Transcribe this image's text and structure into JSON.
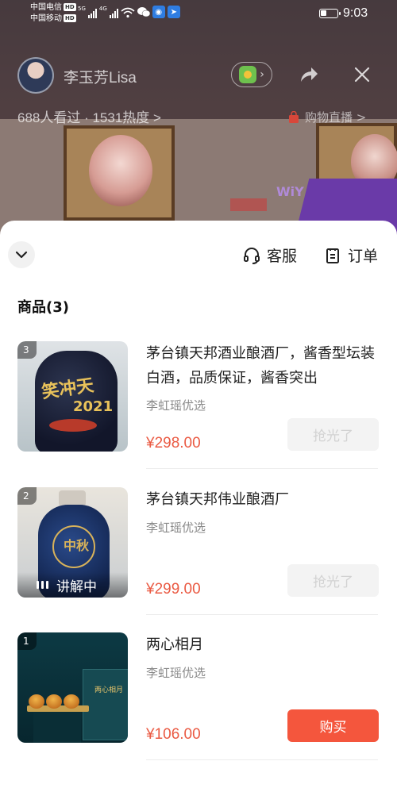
{
  "status_bar": {
    "carrier1": "中国电信",
    "carrier2": "中国移动",
    "hd_badge": "HD",
    "net1": "5G",
    "net2": "4G",
    "time": "9:03",
    "icons": [
      "signal-icon",
      "wifi-icon",
      "wechat-icon",
      "browser-icon",
      "message-icon"
    ]
  },
  "live": {
    "host_name": "李玉芳Lisa",
    "watch_info": "688人看过 · 1531热度 >",
    "shop_live": "购物直播 >"
  },
  "sheet": {
    "customer_service": "客服",
    "orders": "订单",
    "goods_title": "商品(3)"
  },
  "products": [
    {
      "index": "3",
      "title": "茅台镇天邦酒业酿酒厂，酱香型坛装白酒，品质保证，酱香突出",
      "seller": "李虹瑶优选",
      "price": "¥298.00",
      "button": "抢光了",
      "art_text": "笑冲天",
      "art_num": "2021"
    },
    {
      "index": "2",
      "title": "茅台镇天邦伟业酿酒厂",
      "seller": "李虹瑶优选",
      "price": "¥299.00",
      "button": "抢光了",
      "explaining": "讲解中",
      "art_text": "中秋"
    },
    {
      "index": "1",
      "title": "两心相月",
      "seller": "李虹瑶优选",
      "price": "¥106.00",
      "button": "购买",
      "art_text": "两心相月"
    }
  ],
  "colors": {
    "accent": "#f4563d",
    "price": "#ea5a43",
    "seller": "#8a8a8a"
  }
}
